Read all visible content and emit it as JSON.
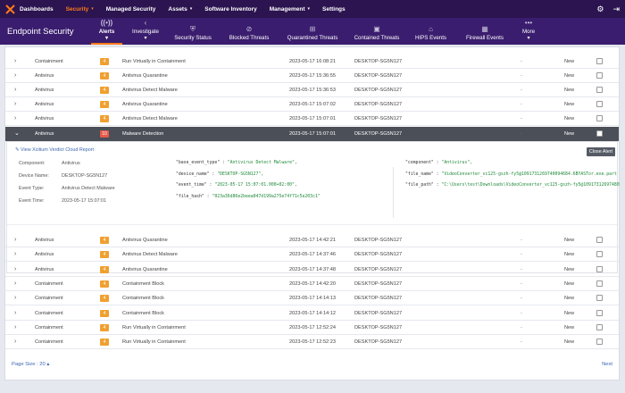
{
  "topnav": {
    "items": [
      {
        "label": "Dashboards",
        "caret": false,
        "active": false
      },
      {
        "label": "Security",
        "caret": true,
        "active": true
      },
      {
        "label": "Managed Security",
        "caret": false,
        "active": false
      },
      {
        "label": "Assets",
        "caret": true,
        "active": false
      },
      {
        "label": "Software Inventory",
        "caret": false,
        "active": false
      },
      {
        "label": "Management",
        "caret": true,
        "active": false
      },
      {
        "label": "Settings",
        "caret": false,
        "active": false
      }
    ],
    "accent_color": "#ff7a1a"
  },
  "subheader": {
    "title": "Endpoint Security",
    "tabs": [
      {
        "label": "Alerts",
        "icon": "broadcast-icon",
        "caret": true,
        "active": true
      },
      {
        "label": "Investigate",
        "icon": "chevron-icon",
        "caret": true,
        "active": false
      },
      {
        "label": "Security Status",
        "icon": "shield-icon",
        "caret": false,
        "active": false
      },
      {
        "label": "Blocked Threats",
        "icon": "block-icon",
        "caret": false,
        "active": false
      },
      {
        "label": "Quarantined Threats",
        "icon": "quarantine-icon",
        "caret": false,
        "active": false
      },
      {
        "label": "Contained Threats",
        "icon": "container-icon",
        "caret": false,
        "active": false
      },
      {
        "label": "HIPS Events",
        "icon": "hips-icon",
        "caret": false,
        "active": false
      },
      {
        "label": "Firewall Events",
        "icon": "firewall-icon",
        "caret": false,
        "active": false
      },
      {
        "label": "More",
        "icon": "more-icon",
        "caret": true,
        "active": false
      }
    ]
  },
  "rows_top": [
    {
      "component": "Containment",
      "severity": "4",
      "type": "Run Virtually in Containment",
      "time": "2023-05-17 16:08:21",
      "device": "DESKTOP-SG5N127",
      "dash": "-",
      "status": "New"
    },
    {
      "component": "Antivirus",
      "severity": "4",
      "type": "Antivirus Quarantine",
      "time": "2023-05-17 15:36:55",
      "device": "DESKTOP-SG5N127",
      "dash": "-",
      "status": "New"
    },
    {
      "component": "Antivirus",
      "severity": "4",
      "type": "Antivirus Detect Malware",
      "time": "2023-05-17 15:36:53",
      "device": "DESKTOP-SG5N127",
      "dash": "-",
      "status": "New"
    },
    {
      "component": "Antivirus",
      "severity": "4",
      "type": "Antivirus Quarantine",
      "time": "2023-05-17 15:07:02",
      "device": "DESKTOP-SG5N127",
      "dash": "-",
      "status": "New"
    },
    {
      "component": "Antivirus",
      "severity": "4",
      "type": "Antivirus Detect Malware",
      "time": "2023-05-17 15:07:01",
      "device": "DESKTOP-SG5N127",
      "dash": "-",
      "status": "New"
    }
  ],
  "expanded_row": {
    "component": "Antivirus",
    "severity": "10",
    "type": "Malware Detection",
    "time": "2023-05-17 15:07:01",
    "device": "DESKTOP-SG5N127",
    "dash": "-",
    "status": "New"
  },
  "detail": {
    "cloud_link": "View Xcitium Verdict Cloud Report",
    "close_button": "Close Alert",
    "fields": [
      {
        "key": "Component:",
        "value": "Antivirus"
      },
      {
        "key": "Device Name:",
        "value": "DESKTOP-SG5N127"
      },
      {
        "key": "Event Type:",
        "value": "Antivirus Detect Malware"
      },
      {
        "key": "Event Time:",
        "value": "2023-05-17 15:07:01"
      }
    ],
    "json_left": [
      {
        "key": "\"base_event_type\" : ",
        "value": "\"Antivirus Detect Malware\","
      },
      {
        "key": "\"device_name\" : ",
        "value": "\"DESKTOP-SG5N127\","
      },
      {
        "key": "\"event_time\" : ",
        "value": "\"2023-05-17 15:07:01.000+02:00\","
      },
      {
        "key": "\"file_hash\" : ",
        "value": "\"023a36d86e2beea047d199a275e74f71c5e203c1\""
      }
    ],
    "json_right": [
      {
        "key": "\"component\" : ",
        "value": "\"Antivirus\","
      },
      {
        "key": "\"file_name\" : ",
        "value": "\"VideoConverter_vc125-gszh-fy5@1091731269740094684.6BYASTor.exe.part"
      },
      {
        "key": "\"file_path\" : ",
        "value": "\"C:\\Users\\test\\Downloads\\VideoConverter_vc125-gszh-fy5@10917312697480"
      }
    ]
  },
  "rows_bottom": [
    {
      "component": "Antivirus",
      "severity": "4",
      "type": "Antivirus Quarantine",
      "time": "2023-05-17 14:42:21",
      "device": "DESKTOP-SG5N127",
      "dash": "-",
      "status": "New"
    },
    {
      "component": "Antivirus",
      "severity": "4",
      "type": "Antivirus Detect Malware",
      "time": "2023-05-17 14:37:46",
      "device": "DESKTOP-SG5N127",
      "dash": "-",
      "status": "New"
    },
    {
      "component": "Antivirus",
      "severity": "4",
      "type": "Antivirus Quarantine",
      "time": "2023-05-17 14:37:48",
      "device": "DESKTOP-SG5N127",
      "dash": "-",
      "status": "New"
    },
    {
      "component": "Containment",
      "severity": "4",
      "type": "Containment Block",
      "time": "2023-05-17 14:42:20",
      "device": "DESKTOP-SG5N127",
      "dash": "-",
      "status": "New"
    },
    {
      "component": "Containment",
      "severity": "4",
      "type": "Containment Block",
      "time": "2023-05-17 14:14:13",
      "device": "DESKTOP-SG5N127",
      "dash": "-",
      "status": "New"
    },
    {
      "component": "Containment",
      "severity": "4",
      "type": "Containment Block",
      "time": "2023-05-17 14:14:12",
      "device": "DESKTOP-SG5N127",
      "dash": "-",
      "status": "New"
    },
    {
      "component": "Containment",
      "severity": "4",
      "type": "Run Virtually in Containment",
      "time": "2023-05-17 12:52:24",
      "device": "DESKTOP-SG5N127",
      "dash": "-",
      "status": "New"
    },
    {
      "component": "Containment",
      "severity": "4",
      "type": "Run Virtually in Containment",
      "time": "2023-05-17 12:52:23",
      "device": "DESKTOP-SG5N127",
      "dash": "-",
      "status": "New"
    }
  ],
  "footer": {
    "page_size": "Page Size : 20",
    "next": "Next"
  },
  "colors": {
    "severity_medium": "#f0a030",
    "severity_high": "#e65a4a",
    "nav_bg": "#2b1450",
    "subnav_bg": "#3a1d6e"
  }
}
